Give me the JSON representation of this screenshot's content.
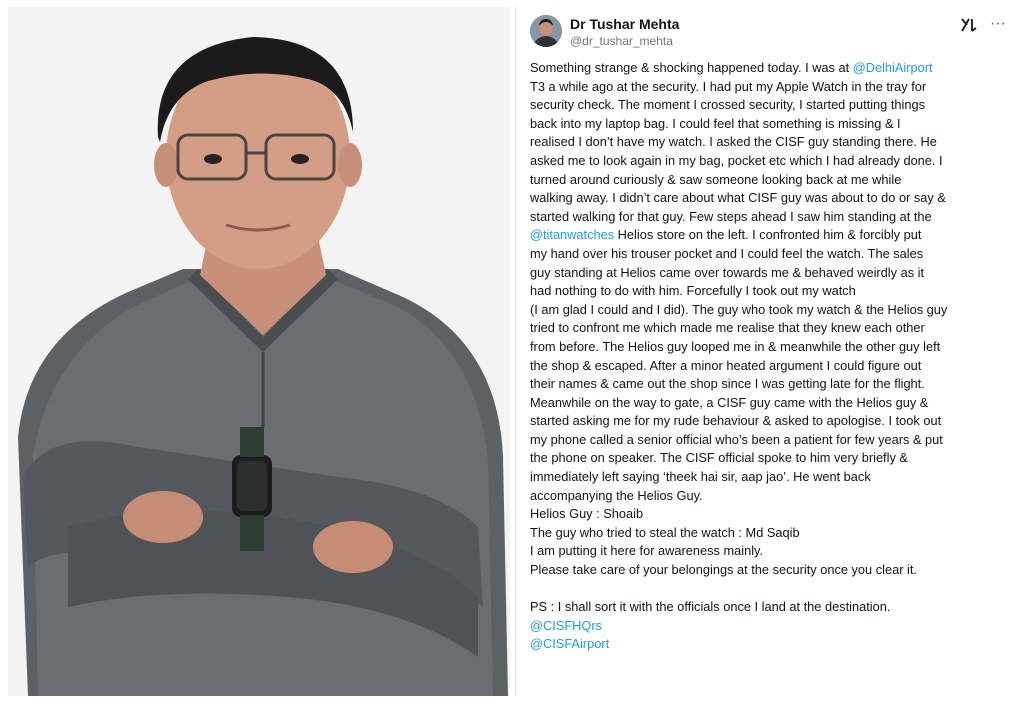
{
  "author": {
    "name": "Dr Tushar Mehta",
    "handle": "@dr_tushar_mehta"
  },
  "icons": {
    "grok": "grok-icon",
    "more": "more-options-icon",
    "more_glyph": "···"
  },
  "colors": {
    "text": "#0f1419",
    "link": "#1d9bf0",
    "handle": "#6b7680"
  },
  "tweet": {
    "lines": [
      [
        "Something strange & shocking happened today. I was at ",
        "@DelhiAirport",
        ""
      ],
      [
        "T3 a while ago at the security. I had put my Apple Watch in the tray for",
        "",
        ""
      ],
      [
        "security check. The moment I crossed security, I started putting things",
        "",
        ""
      ],
      [
        "back into my laptop bag. I could feel that something is missing & I",
        "",
        ""
      ],
      [
        "realised I don’t have my watch. I asked the CISF guy standing there. He",
        "",
        ""
      ],
      [
        "asked me to look again in my bag, pocket etc which I had already done. I",
        "",
        ""
      ],
      [
        "turned around curiously & saw someone looking back at me while",
        "",
        ""
      ],
      [
        "walking away. I didn’t care about what CISF guy was about to do or say &",
        "",
        ""
      ],
      [
        "started walking for that guy. Few steps ahead I saw him standing at the",
        "",
        ""
      ],
      [
        "",
        "@titanwatches",
        " Helios store on the left. I confronted him & forcibly put"
      ],
      [
        "my hand over his trouser pocket and I could feel the watch. The sales",
        "",
        ""
      ],
      [
        "guy standing at Helios came over towards me & behaved weirdly as it",
        "",
        ""
      ],
      [
        "had nothing to do with him. Forcefully I took out my watch",
        "",
        ""
      ],
      [
        "(I am glad I could and I did). The guy who took my watch & the Helios guy",
        "",
        ""
      ],
      [
        "tried to confront me which made me realise that they knew each other",
        "",
        ""
      ],
      [
        "from before. The Helios guy looped me in & meanwhile the other guy left",
        "",
        ""
      ],
      [
        "the shop & escaped. After a minor heated argument I could figure out",
        "",
        ""
      ],
      [
        "their names & came out the shop since I was getting late for the flight.",
        "",
        ""
      ],
      [
        "Meanwhile on the way to gate, a CISF guy came with the Helios guy &",
        "",
        ""
      ],
      [
        "started asking me for my rude behaviour & asked to apologise. I took out",
        "",
        ""
      ],
      [
        "my phone called a senior official who’s been a patient for few years & put",
        "",
        ""
      ],
      [
        "the phone on speaker. The CISF official spoke to him very briefly &",
        "",
        ""
      ],
      [
        "immediately left saying ‘theek hai sir, aap jao’. He went back",
        "",
        ""
      ],
      [
        "accompanying the Helios Guy.",
        "",
        ""
      ],
      [
        "Helios Guy : Shoaib",
        "",
        ""
      ],
      [
        "The guy who tried to steal the watch : Md Saqib",
        "",
        ""
      ],
      [
        "I am putting it here for awareness mainly.",
        "",
        ""
      ],
      [
        "Please take care of your belongings at the security once you clear it.",
        "",
        ""
      ],
      [
        "",
        "",
        ""
      ],
      [
        "PS : I shall sort it with the officials once I land at the destination.",
        "",
        ""
      ],
      [
        "",
        "@CISFHQrs",
        ""
      ],
      [
        "",
        "@CISFAirport",
        ""
      ]
    ]
  }
}
